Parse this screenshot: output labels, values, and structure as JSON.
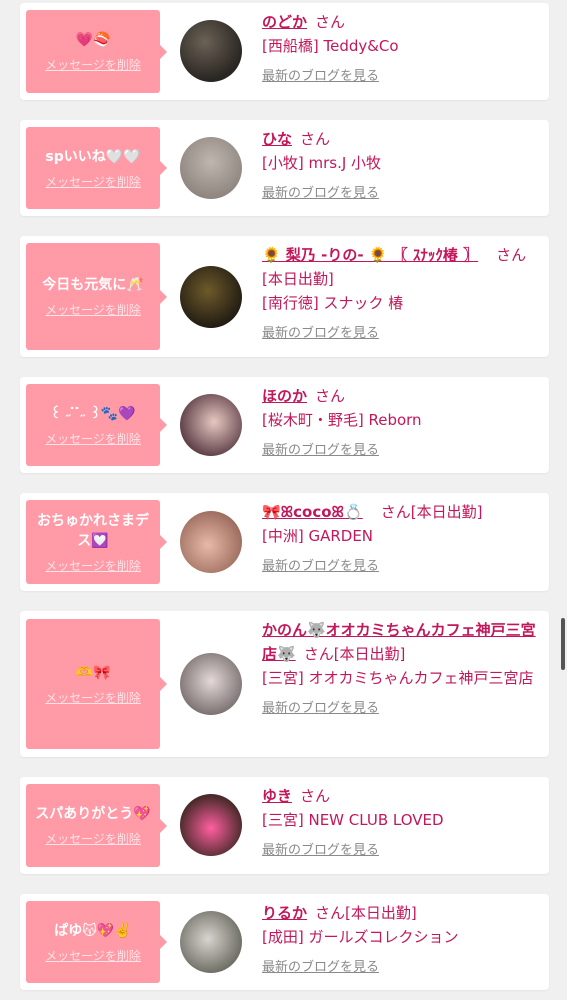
{
  "accent": "#ff9aa6",
  "name_color": "#c2185b",
  "delete_label": "メッセージを削除",
  "blog_label": "最新のブログを見る",
  "san_label": "さん",
  "cards": [
    {
      "message": "💗🍣",
      "name": "のどか",
      "suffix": "",
      "lines": [
        "[西船橋] Teddy&Co"
      ]
    },
    {
      "message": "spいいね🤍🤍",
      "name": "ひな",
      "suffix": "",
      "lines": [
        "[小牧] mrs.J 小牧"
      ]
    },
    {
      "message": "今日も元気に🥂",
      "name": "🌻 梨乃 -りの- 🌻 〖 ｽﾅｯｸ椿 〗",
      "suffix": "",
      "lines": [
        "[本日出勤]",
        "[南行徳] スナック 椿"
      ]
    },
    {
      "message": "꒰ ˶ ̇ ̇˶ ꒱🐾💜",
      "name": "ほのか",
      "suffix": "",
      "lines": [
        "[桜木町・野毛] Reborn"
      ]
    },
    {
      "message": "おちゅかれさまデス💟",
      "name": "🎀ꕤcocoꕤ💍",
      "suffix": "[本日出勤]",
      "lines": [
        "[中洲] GARDEN"
      ]
    },
    {
      "message": "🫶🎀",
      "name": "かのん🐺オオカミちゃんカフェ神戸三宮店🐺",
      "suffix": "[本日出勤]",
      "lines": [
        "[三宮] オオカミちゃんカフェ神戸三宮店"
      ]
    },
    {
      "message": "スパありがとう💖",
      "name": "ゆき",
      "suffix": "",
      "lines": [
        "[三宮] NEW CLUB LOVED"
      ]
    },
    {
      "message": "ぱゆ😽💖✌️",
      "name": "りるか",
      "suffix": "[本日出勤]",
      "lines": [
        "[成田] ガールズコレクション"
      ]
    }
  ]
}
